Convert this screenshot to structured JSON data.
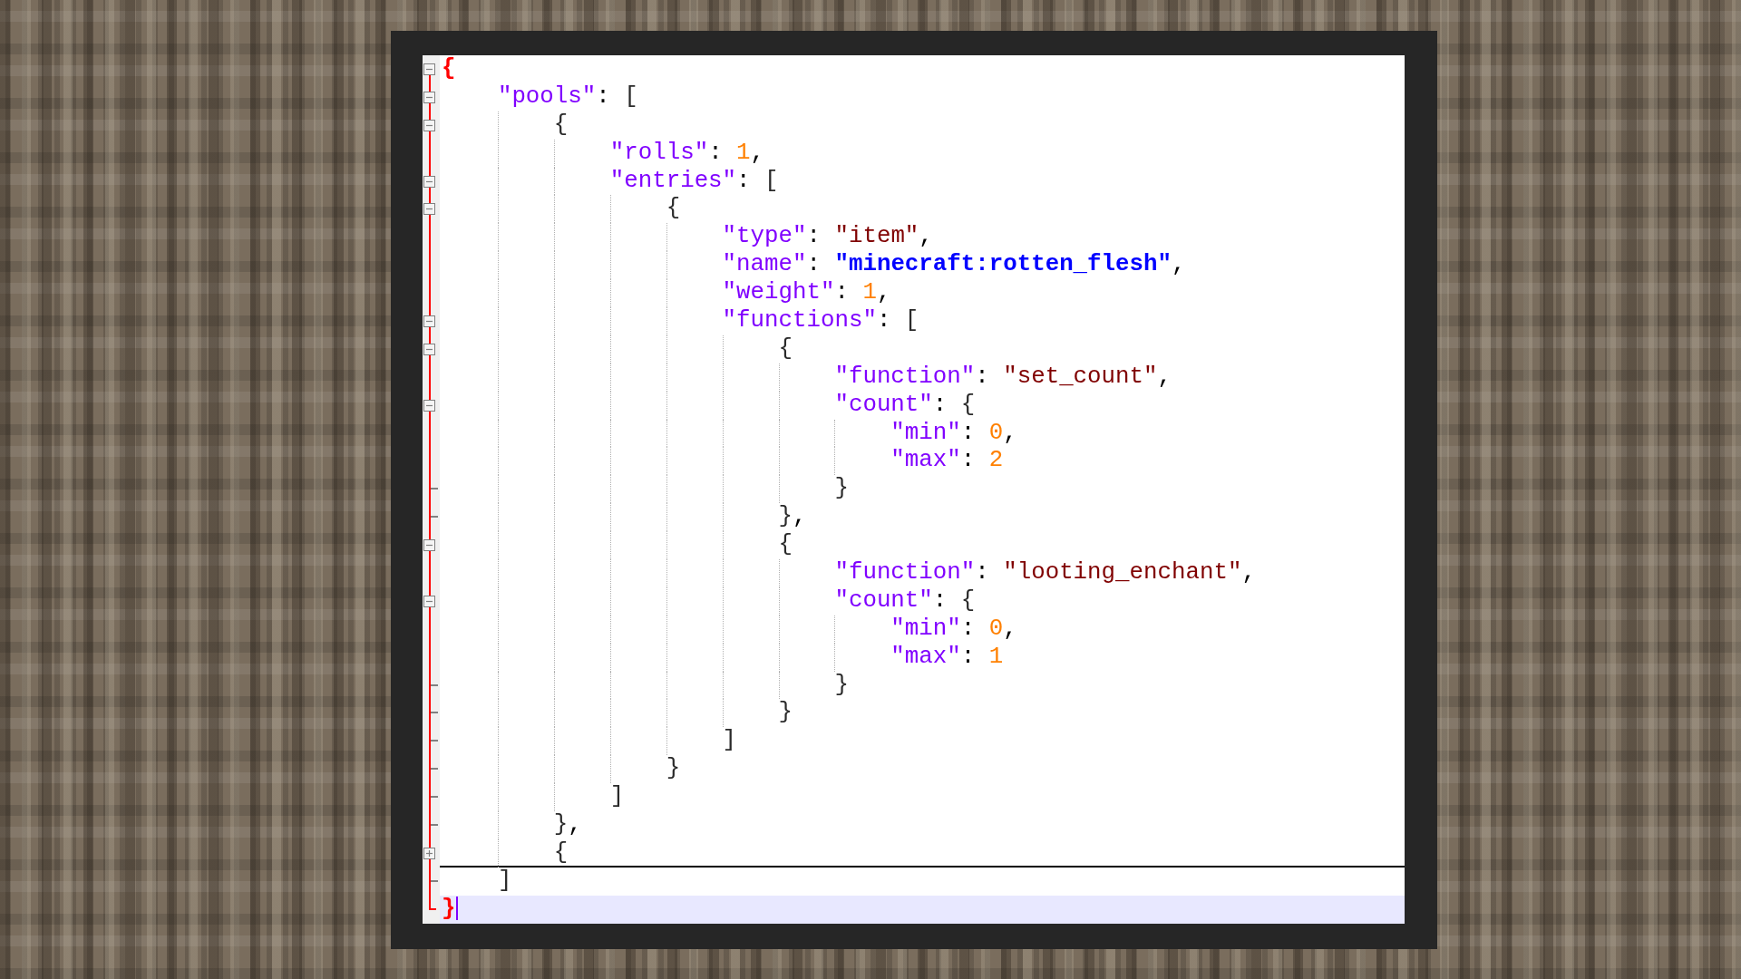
{
  "editor": {
    "lines": [
      {
        "kind": "open",
        "brace_match": true,
        "tokens": [
          {
            "text": "{",
            "kind": "brace"
          }
        ],
        "children": [
          {
            "kind": "open",
            "tokens": [
              {
                "text": "\"pools\"",
                "kind": "key"
              },
              {
                "text": ": ",
                "kind": "punct"
              },
              {
                "text": "[",
                "kind": "brace"
              }
            ],
            "children": [
              {
                "kind": "open",
                "tokens": [
                  {
                    "text": "{",
                    "kind": "brace"
                  }
                ],
                "children": [
                  {
                    "kind": "line",
                    "tokens": [
                      {
                        "text": "\"rolls\"",
                        "kind": "key"
                      },
                      {
                        "text": ": ",
                        "kind": "punct"
                      },
                      {
                        "text": "1",
                        "kind": "number"
                      },
                      {
                        "text": ",",
                        "kind": "punct"
                      }
                    ]
                  },
                  {
                    "kind": "open",
                    "tokens": [
                      {
                        "text": "\"entries\"",
                        "kind": "key"
                      },
                      {
                        "text": ": ",
                        "kind": "punct"
                      },
                      {
                        "text": "[",
                        "kind": "brace"
                      }
                    ],
                    "children": [
                      {
                        "kind": "open",
                        "tokens": [
                          {
                            "text": "{",
                            "kind": "brace"
                          }
                        ],
                        "children": [
                          {
                            "kind": "line",
                            "tokens": [
                              {
                                "text": "\"type\"",
                                "kind": "key"
                              },
                              {
                                "text": ": ",
                                "kind": "punct"
                              },
                              {
                                "text": "\"item\"",
                                "kind": "string"
                              },
                              {
                                "text": ",",
                                "kind": "punct"
                              }
                            ]
                          },
                          {
                            "kind": "line",
                            "tokens": [
                              {
                                "text": "\"name\"",
                                "kind": "key"
                              },
                              {
                                "text": ": ",
                                "kind": "punct"
                              },
                              {
                                "text": "\"minecraft:rotten_flesh\"",
                                "kind": "identifier"
                              },
                              {
                                "text": ",",
                                "kind": "punct"
                              }
                            ]
                          },
                          {
                            "kind": "line",
                            "tokens": [
                              {
                                "text": "\"weight\"",
                                "kind": "key"
                              },
                              {
                                "text": ": ",
                                "kind": "punct"
                              },
                              {
                                "text": "1",
                                "kind": "number"
                              },
                              {
                                "text": ",",
                                "kind": "punct"
                              }
                            ]
                          },
                          {
                            "kind": "open",
                            "tokens": [
                              {
                                "text": "\"functions\"",
                                "kind": "key"
                              },
                              {
                                "text": ": ",
                                "kind": "punct"
                              },
                              {
                                "text": "[",
                                "kind": "brace"
                              }
                            ],
                            "children": [
                              {
                                "kind": "open",
                                "tokens": [
                                  {
                                    "text": "{",
                                    "kind": "brace"
                                  }
                                ],
                                "children": [
                                  {
                                    "kind": "line",
                                    "tokens": [
                                      {
                                        "text": "\"function\"",
                                        "kind": "key"
                                      },
                                      {
                                        "text": ": ",
                                        "kind": "punct"
                                      },
                                      {
                                        "text": "\"set_count\"",
                                        "kind": "string"
                                      },
                                      {
                                        "text": ",",
                                        "kind": "punct"
                                      }
                                    ]
                                  },
                                  {
                                    "kind": "open",
                                    "tokens": [
                                      {
                                        "text": "\"count\"",
                                        "kind": "key"
                                      },
                                      {
                                        "text": ": ",
                                        "kind": "punct"
                                      },
                                      {
                                        "text": "{",
                                        "kind": "brace"
                                      }
                                    ],
                                    "children": [
                                      {
                                        "kind": "line",
                                        "tokens": [
                                          {
                                            "text": "\"min\"",
                                            "kind": "key"
                                          },
                                          {
                                            "text": ": ",
                                            "kind": "punct"
                                          },
                                          {
                                            "text": "0",
                                            "kind": "number"
                                          },
                                          {
                                            "text": ",",
                                            "kind": "punct"
                                          }
                                        ]
                                      },
                                      {
                                        "kind": "line",
                                        "tokens": [
                                          {
                                            "text": "\"max\"",
                                            "kind": "key"
                                          },
                                          {
                                            "text": ": ",
                                            "kind": "punct"
                                          },
                                          {
                                            "text": "2",
                                            "kind": "number"
                                          }
                                        ]
                                      }
                                    ]
                                  },
                                  {
                                    "kind": "close",
                                    "tokens": [
                                      {
                                        "text": "}",
                                        "kind": "brace"
                                      }
                                    ]
                                  }
                                ]
                              },
                              {
                                "kind": "close",
                                "tokens": [
                                  {
                                    "text": "}",
                                    "kind": "brace"
                                  },
                                  {
                                    "text": ",",
                                    "kind": "punct"
                                  }
                                ]
                              },
                              {
                                "kind": "open",
                                "tokens": [
                                  {
                                    "text": "{",
                                    "kind": "brace"
                                  }
                                ],
                                "children": [
                                  {
                                    "kind": "line",
                                    "tokens": [
                                      {
                                        "text": "\"function\"",
                                        "kind": "key"
                                      },
                                      {
                                        "text": ": ",
                                        "kind": "punct"
                                      },
                                      {
                                        "text": "\"looting_enchant\"",
                                        "kind": "string"
                                      },
                                      {
                                        "text": ",",
                                        "kind": "punct"
                                      }
                                    ]
                                  },
                                  {
                                    "kind": "open",
                                    "tokens": [
                                      {
                                        "text": "\"count\"",
                                        "kind": "key"
                                      },
                                      {
                                        "text": ": ",
                                        "kind": "punct"
                                      },
                                      {
                                        "text": "{",
                                        "kind": "brace"
                                      }
                                    ],
                                    "children": [
                                      {
                                        "kind": "line",
                                        "tokens": [
                                          {
                                            "text": "\"min\"",
                                            "kind": "key"
                                          },
                                          {
                                            "text": ": ",
                                            "kind": "punct"
                                          },
                                          {
                                            "text": "0",
                                            "kind": "number"
                                          },
                                          {
                                            "text": ",",
                                            "kind": "punct"
                                          }
                                        ]
                                      },
                                      {
                                        "kind": "line",
                                        "tokens": [
                                          {
                                            "text": "\"max\"",
                                            "kind": "key"
                                          },
                                          {
                                            "text": ": ",
                                            "kind": "punct"
                                          },
                                          {
                                            "text": "1",
                                            "kind": "number"
                                          }
                                        ]
                                      }
                                    ]
                                  },
                                  {
                                    "kind": "close",
                                    "tokens": [
                                      {
                                        "text": "}",
                                        "kind": "brace"
                                      }
                                    ]
                                  }
                                ]
                              },
                              {
                                "kind": "close",
                                "tokens": [
                                  {
                                    "text": "}",
                                    "kind": "brace"
                                  }
                                ]
                              }
                            ]
                          },
                          {
                            "kind": "close",
                            "tokens": [
                              {
                                "text": "]",
                                "kind": "brace"
                              }
                            ]
                          }
                        ]
                      },
                      {
                        "kind": "close",
                        "tokens": [
                          {
                            "text": "}",
                            "kind": "brace"
                          }
                        ]
                      }
                    ]
                  },
                  {
                    "kind": "close",
                    "tokens": [
                      {
                        "text": "]",
                        "kind": "brace"
                      }
                    ]
                  }
                ]
              },
              {
                "kind": "close",
                "tokens": [
                  {
                    "text": "}",
                    "kind": "brace"
                  },
                  {
                    "text": ",",
                    "kind": "punct"
                  }
                ]
              },
              {
                "kind": "collapsed",
                "tokens": [
                  {
                    "text": "{",
                    "kind": "brace"
                  }
                ]
              }
            ]
          },
          {
            "kind": "close",
            "tokens": [
              {
                "text": "]",
                "kind": "brace"
              }
            ]
          }
        ]
      },
      {
        "kind": "end",
        "brace_match": true,
        "current": true,
        "tokens": [
          {
            "text": "}",
            "kind": "brace"
          }
        ]
      }
    ]
  }
}
